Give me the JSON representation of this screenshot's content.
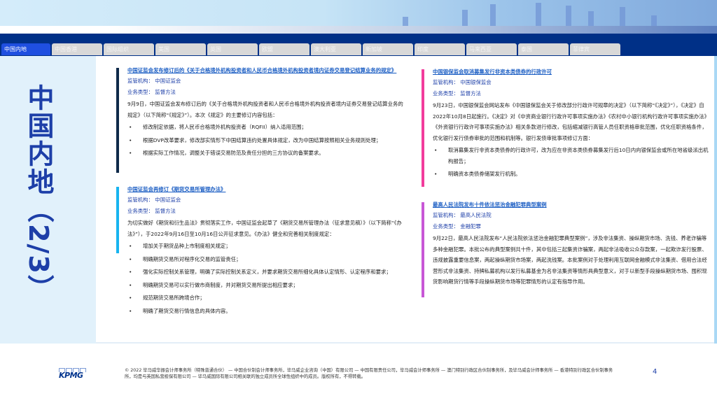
{
  "tabs": [
    "中国内地",
    "中国香港",
    "国际组织",
    "美国",
    "英国",
    "欧盟",
    "澳大利亚",
    "新加坡",
    "印度",
    "马来西亚",
    "泰国",
    "菲律宾"
  ],
  "page_title": "中国内地（2/3）",
  "colors": {
    "navy": "#003087",
    "active_tab": "#1f4fe0",
    "bar1": "#0f2a4a",
    "bar2": "#17b4f0",
    "bar3": "#f23c9c",
    "bar4": "#c857d6"
  },
  "sections": [
    {
      "title": "中国证监会发布修订后的《关于合格境外机构投资者和人民币合格境外机构投资者境内证券交易登记结算业务的规定》",
      "regulator": "监管机构：  中国证监会",
      "type": "业务类型：  监督方法",
      "body": "9月9日，中国证监会发布修订后的《关于合格境外机构投资者和人民币合格境外机构投资者境内证券交易登记结算业务的规定》（以下简称“《规定》”）。本次《规定》的主要修订内容包括：",
      "bullets": [
        "修改制定依据，将人民币合格境外机构投资者（RQFII）纳入适用范围；",
        "根据DVP改革要求，修改部实情形下中国结算违约处置具体规定，改为中国结算按照相关业务规则处理；",
        "根据实际工作情况，调整关于错误交易防范及责任分担的三方协议的备案要求。"
      ]
    },
    {
      "title": "中国证监会再修订《期货交易所管理办法》",
      "regulator": "监管机构：  中国证监会",
      "type": "业务类型：  监督方法",
      "body": "为切实做好《期货和衍生品法》贯彻落实工作，中国证监会起草了《期货交易所管理办法（征求意见稿）》（以下简称“《办法》”），于2022年9月16日至10月16日公开征求意见。《办法》健全和完善相关制度规定：",
      "bullets": [
        "增加关于期货品种上市制度相关规定；",
        "明确期货交易所对程序化交易的监管责任；",
        "强化实际控制关系管理，明确了实际控制关系定义，并要求期货交易所细化具体认定情形、认定程序和要求；",
        "明确期货交易可以实行做市商制度，并对期货交易所提出相应要求；",
        "规范期货交易所跨境合作；",
        "明确了期货交易行情信息的具体内容。"
      ]
    },
    {
      "title": "中国银保监会取消募集发行非资本类债券的行政许可",
      "regulator": "监管机构：  中国银保监会",
      "type": "业务类型：  监督方法",
      "body": "9月23日，中国银保监会网站发布《中国银保监会关于修改部分行政许可规章的决定》（以下简称“《决定》”），《决定》自2022年10月8日起施行。《决定》对《中资商业银行行政许可事项实施办法》《农村中小银行机构行政许可事项实施办法》《外资银行行政许可事项实施办法》相关条款进行修改，包括缩减银行高管人员任职资格审批范围，优化任职资格条件，优化银行发行债券审批的范围和机制等。银行发债审批事项修订方面：",
      "bullets": [
        "取消募集发行非资本类债券的行政许可，改为应在非资本类债券募集发行后10日内向银保监会或所在地省级派出机构报告；",
        "明确资本类债券储架发行机制。"
      ]
    },
    {
      "title": "最高人民法院发布十件依法惩治金融犯罪典型案例",
      "regulator": "监管机构：  最高人民法院",
      "type": "业务类型：  金融犯罪",
      "body": "9月22日，最高人民法院发布“人民法院依法惩治金融犯罪典型案例”，涉及非法集资、操纵期货市场、洗钱、养老诈骗等多种金融犯罪。本批公布的典型案例共十件，其中包括三起集资诈骗案，两起非法吸收公众存款案，一起欺诈发行股票、违规披露重要信息案，两起操纵期货市场案，两起洗钱案。本批案例对于处理利用互联网金融模式非法集资、借用合法经营形式非法集资、持牌私募机构以发行私募基金为名非法集资等情形具典型意义，对于以新型手段操纵期货市场、囤积现货影响期货行情等手段操纵期货市场等犯罪情形的认定有指导作用。",
      "bullets": []
    }
  ],
  "footer": "© 2022 毕马威华振会计师事务所（特殊普通合伙） — 中国合伙制会计师事务所，毕马威企业咨询（中国）有限公司 — 中国有限责任公司，毕马威会计师事务所 — 澳门特别行政区合伙制事务所，及毕马威会计师事务所 — 香港特别行政区合伙制事务所，均是与英国私营担保有限公司 — 毕马威国际有限公司相关联的独立成员所全球性组织中的成员。版权所有，不得转载。",
  "logo": "KPMG",
  "page_number": "4"
}
